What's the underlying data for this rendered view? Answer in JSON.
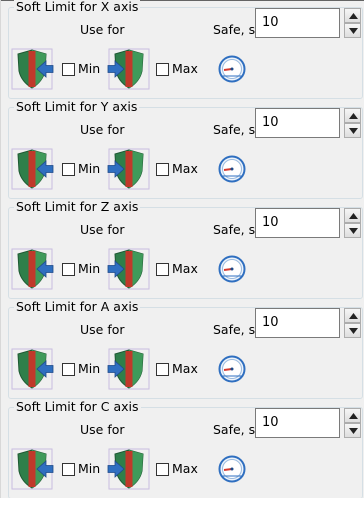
{
  "groups": [
    {
      "title": "Soft Limit for X axis",
      "use_for": "Use for",
      "safe_label": "Safe, slow, mm",
      "min_label": "Min",
      "max_label": "Max",
      "min_checked": false,
      "max_checked": false,
      "value": "10"
    },
    {
      "title": "Soft Limit for Y axis",
      "use_for": "Use for",
      "safe_label": "Safe, slow, mm",
      "min_label": "Min",
      "max_label": "Max",
      "min_checked": false,
      "max_checked": false,
      "value": "10"
    },
    {
      "title": "Soft Limit for Z axis",
      "use_for": "Use for",
      "safe_label": "Safe, slow, mm",
      "min_label": "Min",
      "max_label": "Max",
      "min_checked": false,
      "max_checked": false,
      "value": "10"
    },
    {
      "title": "Soft Limit for A axis",
      "use_for": "Use for",
      "safe_label": "Safe, slow, mm",
      "min_label": "Min",
      "max_label": "Max",
      "min_checked": false,
      "max_checked": false,
      "value": "10"
    },
    {
      "title": "Soft Limit for C axis",
      "use_for": "Use for",
      "safe_label": "Safe, slow, mm",
      "min_label": "Min",
      "max_label": "Max",
      "min_checked": false,
      "max_checked": false,
      "value": "10"
    }
  ],
  "icons": {
    "min": "shield-min-arrow-icon",
    "max": "shield-max-arrow-icon",
    "gauge": "speed-gauge-icon",
    "spin_up": "spin-up-arrow-icon",
    "spin_down": "spin-down-arrow-icon"
  },
  "colors": {
    "shield_green": "#2f7f4a",
    "shield_red": "#c0392b",
    "arrow_blue": "#2f6fc0",
    "group_border": "#d5dfe5",
    "panel_bg": "#f0f0f0"
  }
}
